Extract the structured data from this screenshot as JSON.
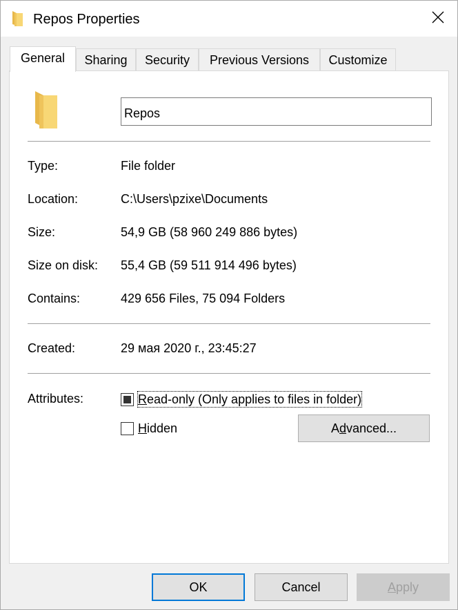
{
  "window": {
    "title": "Repos Properties",
    "icons": {
      "title": "folder-icon",
      "close": "close-icon"
    }
  },
  "tabs": [
    {
      "label": "General",
      "active": true
    },
    {
      "label": "Sharing",
      "active": false
    },
    {
      "label": "Security",
      "active": false
    },
    {
      "label": "Previous Versions",
      "active": false
    },
    {
      "label": "Customize",
      "active": false
    }
  ],
  "general": {
    "name_value": "Repos",
    "folder_icon": "folder-icon",
    "folder_color": "#f8d775",
    "type": {
      "label": "Type:",
      "value": "File folder"
    },
    "location": {
      "label": "Location:",
      "value": "C:\\Users\\pzixe\\Documents"
    },
    "size": {
      "label": "Size:",
      "value": "54,9 GB (58 960 249 886 bytes)"
    },
    "size_on_disk": {
      "label": "Size on disk:",
      "value": "55,4 GB (59 511 914 496 bytes)"
    },
    "contains": {
      "label": "Contains:",
      "value": "429 656 Files, 75 094 Folders"
    },
    "created": {
      "label": "Created:",
      "value": "29 мая 2020 г., 23:45:27"
    },
    "attributes": {
      "label": "Attributes:",
      "readonly": {
        "label_access_key": "R",
        "label_rest": "ead-only (Only applies to files in folder)",
        "state": "indeterminate"
      },
      "hidden": {
        "label_access_key": "H",
        "label_rest": "idden",
        "checked": false
      },
      "advanced_button": {
        "prefix": "A",
        "access_key": "d",
        "rest": "vanced..."
      }
    }
  },
  "buttons": {
    "ok": "OK",
    "cancel": "Cancel",
    "apply_access_key": "A",
    "apply_rest": "pply"
  },
  "colors": {
    "accent": "#0078d7",
    "separator": "#a0a0a0"
  }
}
